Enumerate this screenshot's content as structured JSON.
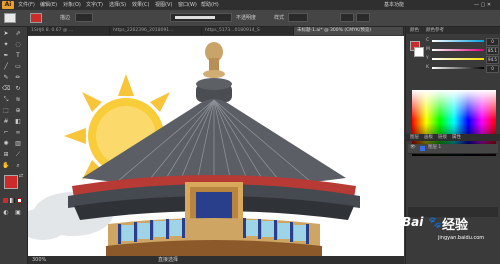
{
  "app": {
    "logo": "Ai"
  },
  "menu": {
    "items": [
      "文件(F)",
      "编辑(E)",
      "对象(O)",
      "文字(T)",
      "选择(S)",
      "效果(C)",
      "视图(V)",
      "窗口(W)",
      "帮助(H)"
    ],
    "workspace": "基本功能"
  },
  "control": {
    "stroke_label": "描边",
    "style_label": "样式",
    "opacity_label": "不透明度"
  },
  "tabs": [
    {
      "label": "1SHJ6 8. 0.67 @ ..."
    },
    {
      "label": "https_2262396_2018091..."
    },
    {
      "label": "https_5173...0180914_S"
    },
    {
      "label": "未标题-1.ai* @ 300% (CMYK/预览)",
      "active": true
    }
  ],
  "panels": {
    "color_tabs": [
      "颜色",
      "颜色参考"
    ],
    "channels": [
      {
        "label": "C",
        "value": "0"
      },
      {
        "label": "M",
        "value": "85.1"
      },
      {
        "label": "Y",
        "value": "94.5"
      },
      {
        "label": "K",
        "value": "0"
      }
    ],
    "layer_tabs": [
      "图层",
      "画板",
      "链接",
      "属性"
    ],
    "layer_name": "图层 1"
  },
  "status": {
    "zoom": "300%",
    "tool_name": "直接选择"
  },
  "watermark": {
    "brand": "Bai",
    "text": "经验",
    "url": "jingyan.baidu.com"
  },
  "colors": {
    "fill": "#cc2b2b",
    "stroke": "#ffffff",
    "ui_dark": "#3a3a3a"
  },
  "icons": [
    "selection-arrow-icon",
    "direct-selection-icon",
    "pen-icon",
    "type-icon",
    "brush-icon",
    "hand-icon",
    "zoom-icon",
    "swap-icon"
  ]
}
